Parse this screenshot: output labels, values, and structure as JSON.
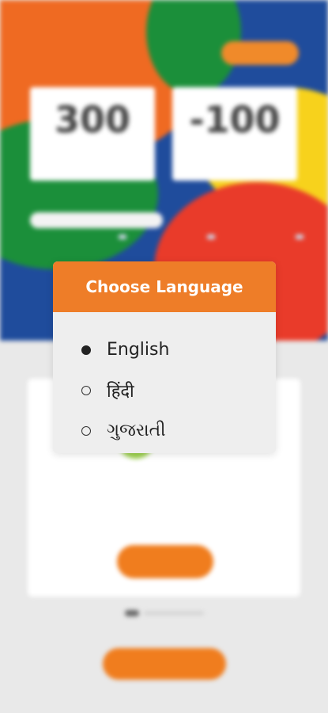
{
  "modal": {
    "title": "Choose Language",
    "options": [
      {
        "label": "English",
        "selected": true
      },
      {
        "label": "हिंदी",
        "selected": false
      },
      {
        "label": "ગુજરાતી",
        "selected": false
      }
    ]
  },
  "background": {
    "cards": [
      {
        "value": "300"
      },
      {
        "value": "-100"
      }
    ]
  },
  "colors": {
    "accent": "#ee7d28",
    "hero_blue": "#1f4c9c",
    "hero_orange": "#ef6a22",
    "hero_green": "#1b8f3a",
    "hero_yellow": "#f7d21c",
    "hero_red": "#e93b2a"
  }
}
